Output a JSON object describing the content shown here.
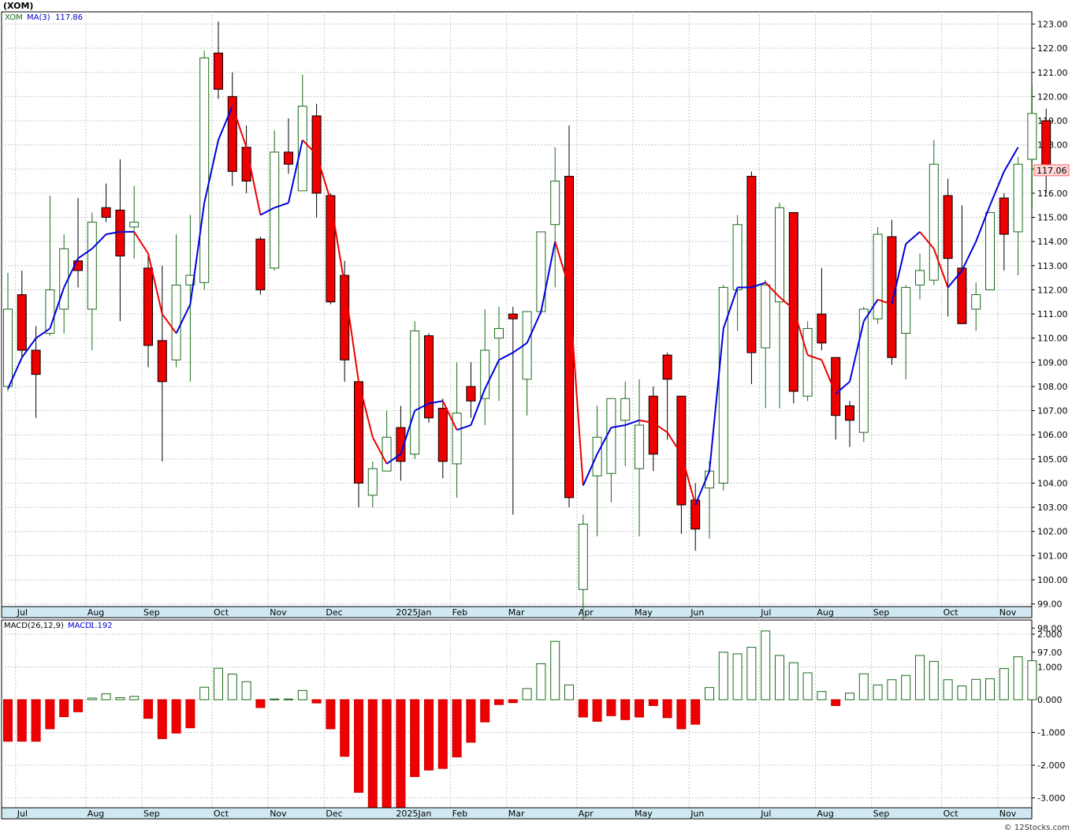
{
  "title": "(XOM)",
  "watermark": "© 12Stocks.com",
  "chart_data": [
    {
      "type": "candlestick",
      "symbol": "XOM",
      "legend": {
        "symbol_label": "XOM",
        "ma_label": "MA(3)",
        "ma_value": "117.86"
      },
      "last_price_label": "117.06",
      "ylim": [
        97,
        123.5
      ],
      "yticks": [
        "97.00",
        "98.00",
        "99.00",
        "100.00",
        "101.00",
        "102.00",
        "103.00",
        "104.00",
        "105.00",
        "106.00",
        "107.00",
        "108.00",
        "109.00",
        "110.00",
        "111.00",
        "112.00",
        "113.00",
        "114.00",
        "115.00",
        "116.00",
        "117.00",
        "118.00",
        "119.00",
        "120.00",
        "121.00",
        "122.00",
        "123.00"
      ],
      "xlabels": [
        {
          "i": 1,
          "t": "Jul"
        },
        {
          "i": 6,
          "t": "Aug"
        },
        {
          "i": 10,
          "t": "Sep"
        },
        {
          "i": 15,
          "t": "Oct"
        },
        {
          "i": 19,
          "t": "Nov"
        },
        {
          "i": 23,
          "t": "Dec"
        },
        {
          "i": 28,
          "t": "2025Jan"
        },
        {
          "i": 32,
          "t": "Feb"
        },
        {
          "i": 36,
          "t": "Mar"
        },
        {
          "i": 41,
          "t": "Apr"
        },
        {
          "i": 45,
          "t": "May"
        },
        {
          "i": 49,
          "t": "Jun"
        },
        {
          "i": 54,
          "t": "Jul"
        },
        {
          "i": 58,
          "t": "Aug"
        },
        {
          "i": 62,
          "t": "Sep"
        },
        {
          "i": 67,
          "t": "Oct"
        },
        {
          "i": 71,
          "t": "Nov"
        }
      ],
      "colors": {
        "up": "#1a6b1a",
        "down": "#ee0000",
        "ma_up": "#0000dd",
        "ma_down": "#ee0000"
      },
      "ohlc": [
        [
          108,
          112.7,
          107.8,
          111.2
        ],
        [
          111.8,
          112.8,
          109.2,
          109.5
        ],
        [
          109.5,
          110.5,
          106.7,
          108.5
        ],
        [
          110.2,
          115.9,
          110.1,
          112
        ],
        [
          111.2,
          114.3,
          110.2,
          113.7
        ],
        [
          113.2,
          115.8,
          112.1,
          112.8
        ],
        [
          111.2,
          115.2,
          109.5,
          114.8
        ],
        [
          115.4,
          116.4,
          114.8,
          115
        ],
        [
          115.3,
          117.4,
          110.7,
          113.4
        ],
        [
          114.6,
          116.3,
          113.3,
          114.8
        ],
        [
          112.9,
          113.4,
          108.8,
          109.7
        ],
        [
          109.9,
          113,
          104.9,
          108.2
        ],
        [
          109.1,
          114.3,
          108.8,
          112.2
        ],
        [
          112.2,
          115.1,
          108.2,
          112.6
        ],
        [
          112.3,
          121.9,
          112,
          121.6
        ],
        [
          121.8,
          123.1,
          119.9,
          120.3
        ],
        [
          120,
          121,
          116.3,
          116.9
        ],
        [
          117.9,
          118.8,
          116,
          116.5
        ],
        [
          114.1,
          114.2,
          111.8,
          112
        ],
        [
          112.9,
          118.6,
          112.8,
          117.7
        ],
        [
          117.7,
          119.1,
          116.8,
          117.2
        ],
        [
          116.1,
          120.9,
          116.3,
          119.6
        ],
        [
          119.2,
          119.7,
          115,
          116
        ],
        [
          115.9,
          116,
          111.4,
          111.5
        ],
        [
          112.6,
          113.2,
          108.2,
          109.1
        ],
        [
          108.2,
          108.3,
          103,
          104
        ],
        [
          103.5,
          104.9,
          103,
          104.6
        ],
        [
          104.5,
          107,
          104.5,
          105.9
        ],
        [
          106.3,
          107.2,
          104.1,
          104.9
        ],
        [
          105.2,
          110.7,
          105,
          110.3
        ],
        [
          110.1,
          110.2,
          106.5,
          106.7
        ],
        [
          107.1,
          107.5,
          104.2,
          104.9
        ],
        [
          104.8,
          109,
          103.4,
          106.9
        ],
        [
          108,
          109,
          106.7,
          107.4
        ],
        [
          107.5,
          111.2,
          106.4,
          109.5
        ],
        [
          110,
          111.3,
          107.4,
          110.4
        ],
        [
          111,
          111.3,
          102.7,
          110.8
        ],
        [
          108.3,
          111,
          106.8,
          111.1
        ],
        [
          111.1,
          113.5,
          111,
          114.4
        ],
        [
          114.7,
          117.9,
          112.1,
          116.5
        ],
        [
          116.7,
          118.8,
          103,
          103.4
        ],
        [
          99.6,
          102.7,
          97,
          102.3
        ],
        [
          104.3,
          107.2,
          101.8,
          105.9
        ],
        [
          104.4,
          107.5,
          103.2,
          107.5
        ],
        [
          106.6,
          108.2,
          104.7,
          107.5
        ],
        [
          104.6,
          108.3,
          101.8,
          106.4
        ],
        [
          107.6,
          108,
          104.5,
          105.2
        ],
        [
          109.3,
          109.4,
          105.8,
          108.3
        ],
        [
          107.6,
          107.6,
          101.9,
          103.1
        ],
        [
          103.3,
          104,
          101.2,
          102.1
        ],
        [
          103.8,
          104.9,
          101.7,
          104.5
        ],
        [
          104,
          112.2,
          103.7,
          112.1
        ],
        [
          112,
          115.1,
          110.3,
          114.7
        ],
        [
          116.7,
          116.9,
          108.1,
          109.4
        ],
        [
          109.6,
          112.4,
          107.1,
          112.2
        ],
        [
          111.5,
          115.6,
          107.1,
          115.4
        ],
        [
          115.2,
          115.2,
          107.3,
          107.8
        ],
        [
          107.6,
          110.7,
          107.4,
          110.4
        ],
        [
          111,
          112.9,
          109.5,
          109.8
        ],
        [
          109.2,
          109.2,
          105.8,
          106.8
        ],
        [
          107.2,
          107.4,
          105.5,
          106.6
        ],
        [
          106.1,
          111.3,
          105.7,
          111.2
        ],
        [
          110.8,
          114.6,
          110.6,
          114.3
        ],
        [
          114.2,
          114.9,
          108.9,
          109.2
        ],
        [
          110.2,
          112.2,
          108.3,
          112.1
        ],
        [
          112.2,
          113.5,
          111.6,
          112.8
        ],
        [
          112.4,
          118.2,
          112.2,
          117.2
        ],
        [
          115.9,
          116.6,
          110.9,
          113.3
        ],
        [
          112.9,
          115.5,
          110.6,
          110.6
        ],
        [
          111.2,
          112.3,
          110.3,
          111.8
        ],
        [
          112,
          115.2,
          112,
          115.2
        ],
        [
          115.8,
          116,
          112.8,
          114.3
        ],
        [
          114.4,
          117.5,
          112.6,
          117.2
        ],
        [
          117.4,
          120.5,
          115.4,
          119.3
        ],
        [
          119,
          119.5,
          116,
          117.1
        ]
      ],
      "ma3": [
        107.9,
        109.2,
        110,
        110.4,
        112.1,
        113.3,
        113.7,
        114.3,
        114.4,
        114.4,
        113.5,
        111,
        110.2,
        111.4,
        115.6,
        118.2,
        119.6,
        117.9,
        115.1,
        115.4,
        115.6,
        118.2,
        117.6,
        115.7,
        112.2,
        108.2,
        105.9,
        104.8,
        105.2,
        107,
        107.3,
        107.4,
        106.2,
        106.4,
        107.9,
        109.1,
        109.4,
        109.8,
        111.1,
        114,
        112.1,
        103.9,
        105.2,
        106.3,
        106.4,
        106.6,
        106.5,
        106.1,
        105.2,
        103.1,
        104.5,
        110.4,
        112.1,
        112.1,
        112.3,
        111.7,
        111.2,
        109.3,
        109.1,
        107.7,
        108.2,
        110.7,
        111.6,
        111.4,
        113.9,
        114.4,
        113.7,
        112.1,
        112.8,
        114,
        115.5,
        116.9,
        117.9
      ]
    },
    {
      "type": "bar",
      "title": "MACD(26,12,9)",
      "legend": {
        "label": "MACD(26,12,9)",
        "value_label": "MACD",
        "value": "1.192"
      },
      "ylim": [
        -3.3,
        2.2
      ],
      "yticks": [
        "-3.000",
        "-2.000",
        "-1.000",
        "0.000",
        "1.000",
        "2.000"
      ],
      "values": [
        -1.27,
        -1.27,
        -1.27,
        -0.89,
        -0.52,
        -0.37,
        0.05,
        0.18,
        0.06,
        0.1,
        -0.57,
        -1.19,
        -1.02,
        -0.86,
        0.38,
        0.96,
        0.78,
        0.55,
        -0.24,
        0.02,
        0.02,
        0.28,
        -0.1,
        -0.89,
        -1.73,
        -2.83,
        -3.3,
        -3.3,
        -3.3,
        -2.35,
        -2.15,
        -2.1,
        -1.75,
        -1.3,
        -0.68,
        -0.15,
        -0.09,
        0.34,
        1.1,
        1.78,
        0.45,
        -0.53,
        -0.66,
        -0.49,
        -0.61,
        -0.53,
        -0.18,
        -0.55,
        -0.89,
        -0.75,
        0.37,
        1.45,
        1.4,
        1.6,
        2.1,
        1.35,
        1.13,
        0.82,
        0.25,
        -0.18,
        0.2,
        0.79,
        0.45,
        0.61,
        0.74,
        1.35,
        1.17,
        0.61,
        0.42,
        0.62,
        0.64,
        0.95,
        1.31,
        1.19
      ]
    }
  ]
}
